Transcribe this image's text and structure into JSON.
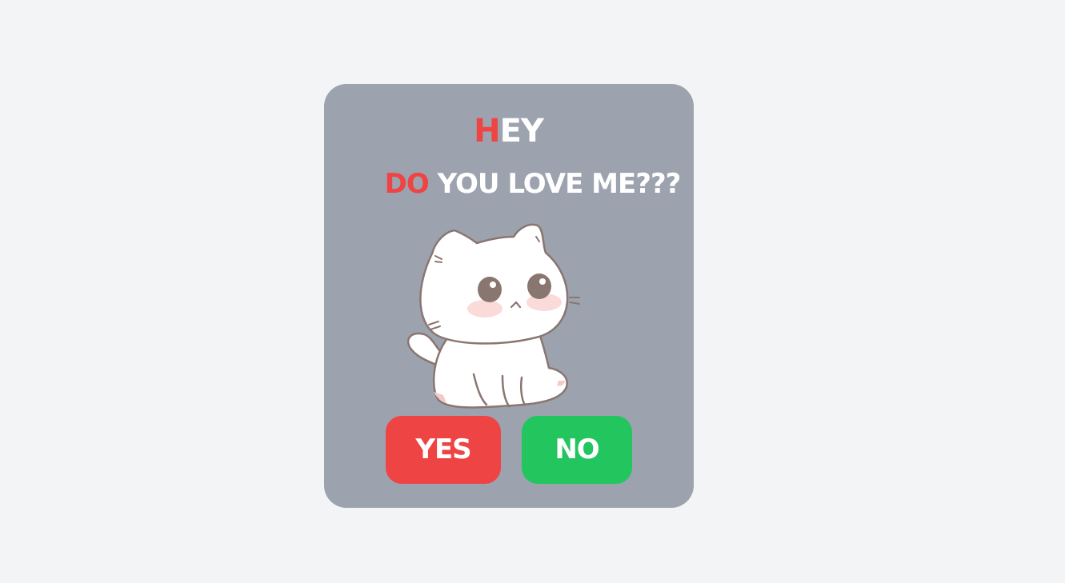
{
  "dialog": {
    "greeting_first_letter": "H",
    "greeting_rest": "EY",
    "question_accent": "DO",
    "question_rest": " YOU LOVE ME???"
  },
  "illustration": {
    "icon": "cat-icon"
  },
  "buttons": {
    "yes_label": "YES",
    "no_label": "NO"
  },
  "colors": {
    "background": "#f3f4f6",
    "card": "#9ca3af",
    "accent": "#ef4444",
    "yes": "#ef4444",
    "no": "#22c55e",
    "text": "#ffffff"
  }
}
